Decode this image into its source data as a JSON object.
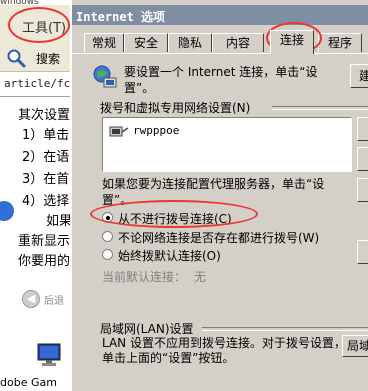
{
  "background_window": {
    "top_text": "windows",
    "menu_tools": "工具(T)",
    "search_label": "搜索",
    "address": "article/fc",
    "lines": [
      "其次设置",
      "1）单击",
      "2）在语",
      "3）在首",
      "4）选择",
      "如果",
      "重新显示",
      "你要用的"
    ],
    "back_label": "后退",
    "app_label": "dobe Gam"
  },
  "dialog": {
    "title": "Internet 选项",
    "tabs": [
      "常规",
      "安全",
      "隐私",
      "内容",
      "连接",
      "程序"
    ],
    "active_tab": "连接",
    "setup_text": "要设置一个 Internet 连接，单击“设置”。",
    "setup_button": "建",
    "dialup_group": "拨号和虚拟专用网络设置(N)",
    "connections": [
      "rwpppoe"
    ],
    "proxy_text": "如果您要为连接配置代理服务器，单击“设置”。",
    "radios": [
      {
        "label": "从不进行拨号连接(C)",
        "selected": true
      },
      {
        "label": "不论网络连接是否存在都进行拨号(W)",
        "selected": false
      },
      {
        "label": "始终拨默认连接(O)",
        "selected": false
      }
    ],
    "default_label": "当前默认连接：",
    "default_value": "无",
    "lan_group": "局域网(LAN)设置",
    "lan_text": "LAN 设置不应用到拨号连接。对于拨号设置，单击上面的“设置”按钮。",
    "lan_button": "局域"
  },
  "colors": {
    "highlight_ring": "#ee3333",
    "title_bar": "#7f8ea3"
  }
}
